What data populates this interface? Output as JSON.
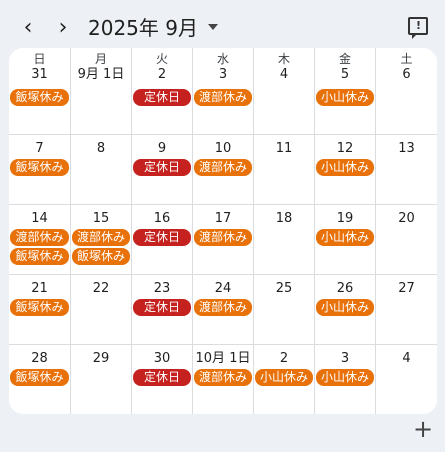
{
  "header": {
    "prev_icon": "‹",
    "next_icon": "›",
    "title": "2025年 9月",
    "feedback_icon": "feedback-icon"
  },
  "weekdays": [
    "日",
    "月",
    "火",
    "水",
    "木",
    "金",
    "土"
  ],
  "colors": {
    "orange": "#e8710a",
    "red": "#c5221f"
  },
  "weeks": [
    {
      "days": [
        {
          "label": "31",
          "events": [
            {
              "text": "飯塚休み",
              "color": "orange"
            }
          ]
        },
        {
          "label": "9月 1日",
          "events": []
        },
        {
          "label": "2",
          "events": [
            {
              "text": "定休日",
              "color": "red"
            }
          ]
        },
        {
          "label": "3",
          "events": [
            {
              "text": "渡部休み",
              "color": "orange"
            }
          ]
        },
        {
          "label": "4",
          "events": []
        },
        {
          "label": "5",
          "events": [
            {
              "text": "小山休み",
              "color": "orange"
            }
          ]
        },
        {
          "label": "6",
          "events": []
        }
      ]
    },
    {
      "days": [
        {
          "label": "7",
          "events": [
            {
              "text": "飯塚休み",
              "color": "orange"
            }
          ]
        },
        {
          "label": "8",
          "events": []
        },
        {
          "label": "9",
          "events": [
            {
              "text": "定休日",
              "color": "red"
            }
          ]
        },
        {
          "label": "10",
          "events": [
            {
              "text": "渡部休み",
              "color": "orange"
            }
          ]
        },
        {
          "label": "11",
          "events": []
        },
        {
          "label": "12",
          "events": [
            {
              "text": "小山休み",
              "color": "orange"
            }
          ]
        },
        {
          "label": "13",
          "events": []
        }
      ]
    },
    {
      "days": [
        {
          "label": "14",
          "events": [
            {
              "text": "渡部休み",
              "color": "orange"
            },
            {
              "text": "飯塚休み",
              "color": "orange"
            }
          ]
        },
        {
          "label": "15",
          "events": [
            {
              "text": "渡部休み",
              "color": "orange"
            },
            {
              "text": "飯塚休み",
              "color": "orange"
            }
          ]
        },
        {
          "label": "16",
          "events": [
            {
              "text": "定休日",
              "color": "red"
            }
          ]
        },
        {
          "label": "17",
          "events": [
            {
              "text": "渡部休み",
              "color": "orange"
            }
          ]
        },
        {
          "label": "18",
          "events": []
        },
        {
          "label": "19",
          "events": [
            {
              "text": "小山休み",
              "color": "orange"
            }
          ]
        },
        {
          "label": "20",
          "events": []
        }
      ]
    },
    {
      "days": [
        {
          "label": "21",
          "events": [
            {
              "text": "飯塚休み",
              "color": "orange"
            }
          ]
        },
        {
          "label": "22",
          "events": []
        },
        {
          "label": "23",
          "events": [
            {
              "text": "定休日",
              "color": "red"
            }
          ]
        },
        {
          "label": "24",
          "events": [
            {
              "text": "渡部休み",
              "color": "orange"
            }
          ]
        },
        {
          "label": "25",
          "events": []
        },
        {
          "label": "26",
          "events": [
            {
              "text": "小山休み",
              "color": "orange"
            }
          ]
        },
        {
          "label": "27",
          "events": []
        }
      ]
    },
    {
      "days": [
        {
          "label": "28",
          "events": [
            {
              "text": "飯塚休み",
              "color": "orange"
            }
          ]
        },
        {
          "label": "29",
          "events": []
        },
        {
          "label": "30",
          "events": [
            {
              "text": "定休日",
              "color": "red"
            }
          ]
        },
        {
          "label": "10月 1日",
          "events": [
            {
              "text": "渡部休み",
              "color": "orange"
            }
          ]
        },
        {
          "label": "2",
          "events": [
            {
              "text": "小山休み",
              "color": "orange"
            }
          ]
        },
        {
          "label": "3",
          "events": [
            {
              "text": "小山休み",
              "color": "orange"
            }
          ]
        },
        {
          "label": "4",
          "events": []
        }
      ]
    }
  ],
  "fab": {
    "label": "+",
    "icon": "plus-icon"
  }
}
